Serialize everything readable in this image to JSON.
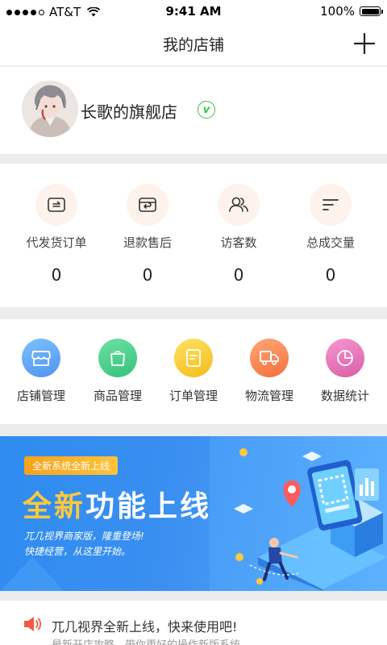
{
  "status_bar": {
    "carrier": "AT&T",
    "time": "9:41 AM",
    "battery": "100%"
  },
  "nav": {
    "title": "我的店铺",
    "add_icon": "plus-icon"
  },
  "profile": {
    "shop_name": "长歌的旗舰店",
    "verified_mark": "v"
  },
  "stats": [
    {
      "label": "代发货订单",
      "value": "0",
      "icon": "ship-order-icon"
    },
    {
      "label": "退款售后",
      "value": "0",
      "icon": "refund-icon"
    },
    {
      "label": "访客数",
      "value": "0",
      "icon": "visitors-icon"
    },
    {
      "label": "总成交量",
      "value": "0",
      "icon": "sort-volume-icon"
    }
  ],
  "functions": [
    {
      "label": "店铺管理",
      "icon": "shop-icon",
      "color": "#5aa4f4"
    },
    {
      "label": "商品管理",
      "icon": "bag-icon",
      "color": "#4ad08a"
    },
    {
      "label": "订单管理",
      "icon": "order-doc-icon",
      "color": "#f6cb2f"
    },
    {
      "label": "物流管理",
      "icon": "truck-icon",
      "color": "#f5834e"
    },
    {
      "label": "数据统计",
      "icon": "pie-chart-icon",
      "color": "#e26fb0"
    }
  ],
  "banner": {
    "tag": "全新系统全新上线",
    "title_highlight": "全新",
    "title_rest": "功能上线",
    "sub_line1": "兀几视界商家版，隆重登场!",
    "sub_line2": "快捷经营，从这里开始。"
  },
  "notice": {
    "icon": "speaker-icon",
    "title": "兀几视界全新上线，快来使用吧!",
    "subtitle": "最新开店攻略，带你更好的操作新版系统"
  }
}
